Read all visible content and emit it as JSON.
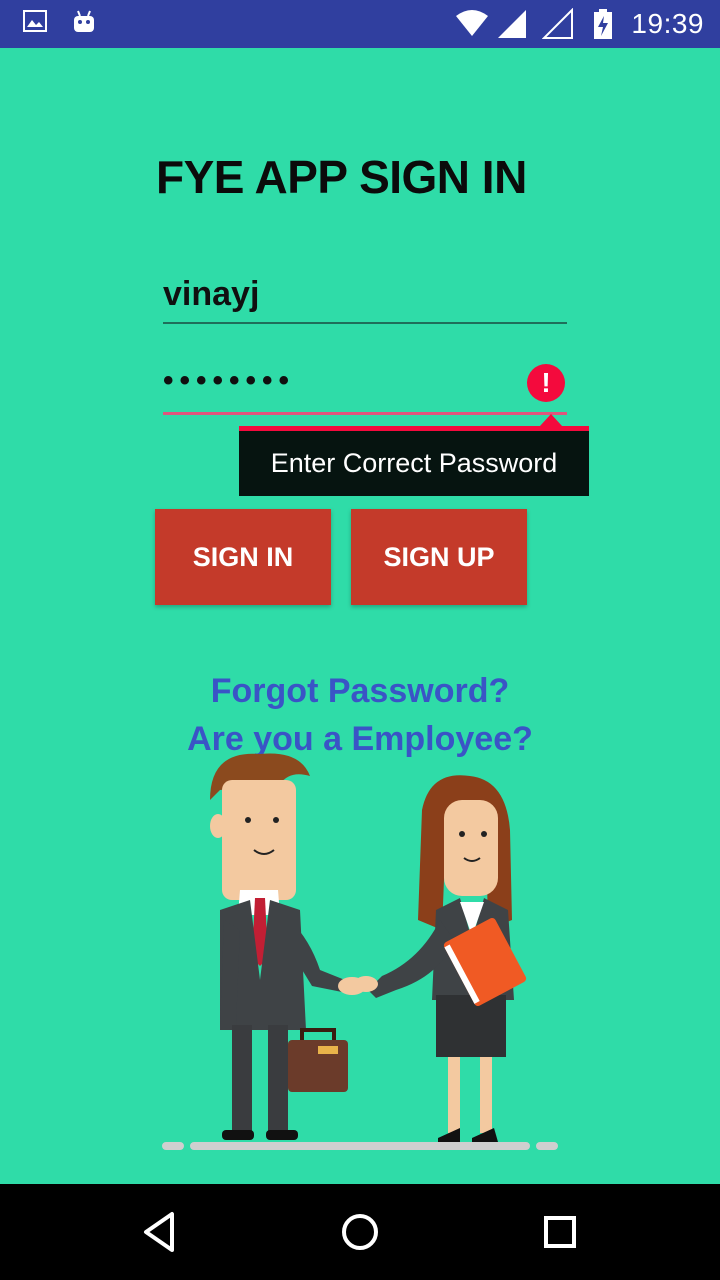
{
  "status_bar": {
    "time": "19:39",
    "icons": [
      "image-icon",
      "android-icon",
      "wifi-icon",
      "signal-icon",
      "signal-empty-icon",
      "battery-icon"
    ]
  },
  "screen": {
    "title": "FYE APP SIGN IN",
    "username": {
      "value": "vinayj"
    },
    "password": {
      "value": "••••••••",
      "error": "Enter Correct Password"
    },
    "buttons": {
      "sign_in": "SIGN IN",
      "sign_up": "SIGN UP"
    },
    "links": {
      "forgot_password": "Forgot Password?",
      "employee": "Are you a Employee?"
    }
  },
  "nav_bar": {
    "icons": [
      "back-icon",
      "home-icon",
      "recents-icon"
    ]
  },
  "colors": {
    "background": "#2fdca8",
    "status_bar": "#303f9f",
    "button": "#c43a2a",
    "error": "#f40a3d",
    "link": "#3a54c6"
  }
}
